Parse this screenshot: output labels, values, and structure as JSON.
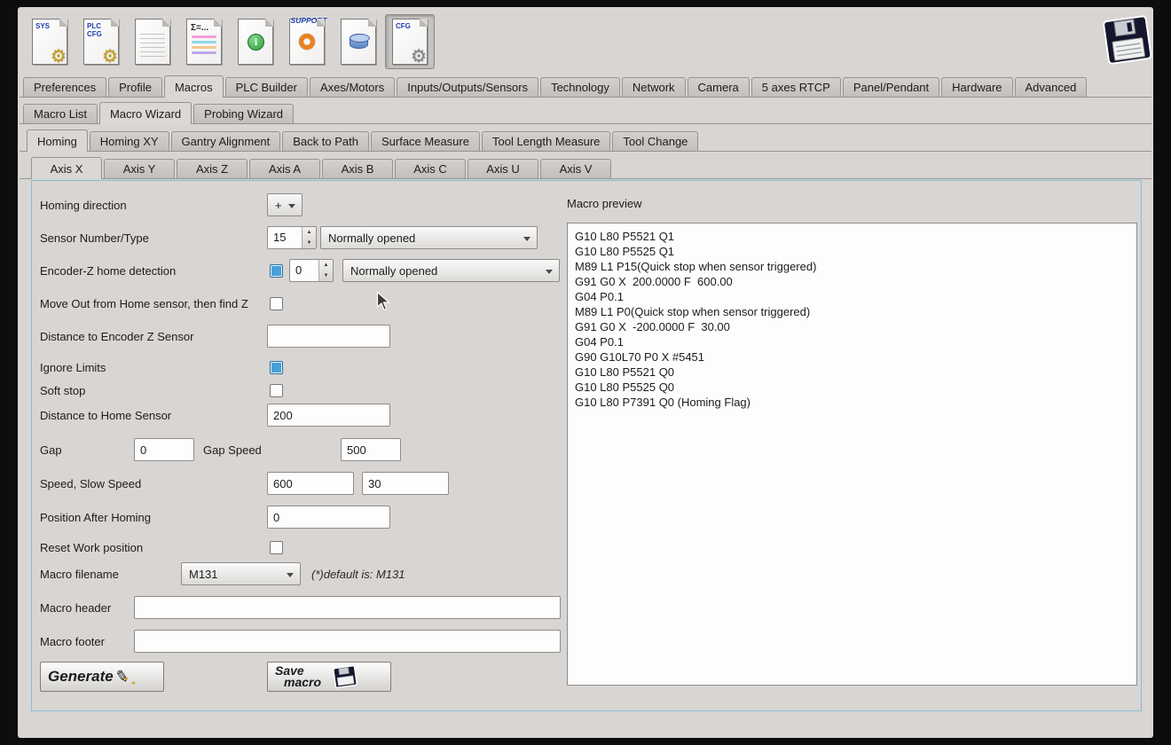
{
  "toolbar": {
    "icons": [
      {
        "name": "sys-config-icon",
        "label": "SYS"
      },
      {
        "name": "plc-cfg-icon",
        "label": "PLC\nCFG"
      },
      {
        "name": "document-icon",
        "label": ""
      },
      {
        "name": "macro-list-icon",
        "label": "Σ=..."
      },
      {
        "name": "info-icon",
        "label": "i"
      },
      {
        "name": "support-icon",
        "label": "SUPPORT"
      },
      {
        "name": "database-icon",
        "label": ""
      },
      {
        "name": "cfg-icon",
        "label": "CFG"
      }
    ]
  },
  "main_tabs": {
    "active": "Macros",
    "items": [
      "Preferences",
      "Profile",
      "Macros",
      "PLC Builder",
      "Axes/Motors",
      "Inputs/Outputs/Sensors",
      "Technology",
      "Network",
      "Camera",
      "5 axes RTCP",
      "Panel/Pendant",
      "Hardware",
      "Advanced"
    ]
  },
  "macro_tabs": {
    "active": "Macro Wizard",
    "items": [
      "Macro List",
      "Macro Wizard",
      "Probing Wizard"
    ]
  },
  "wizard_tabs": {
    "active": "Homing",
    "items": [
      "Homing",
      "Homing XY",
      "Gantry Alignment",
      "Back to Path",
      "Surface Measure",
      "Tool Length Measure",
      "Tool Change"
    ]
  },
  "axis_tabs": {
    "active": "Axis X",
    "items": [
      "Axis X",
      "Axis Y",
      "Axis Z",
      "Axis A",
      "Axis B",
      "Axis C",
      "Axis U",
      "Axis V"
    ]
  },
  "form": {
    "homing_direction": {
      "label": "Homing direction",
      "value": "+"
    },
    "sensor_number": {
      "label": "Sensor Number/Type",
      "value": "15",
      "type_value": "Normally opened"
    },
    "encoder_z": {
      "label": "Encoder-Z home detection",
      "checked": true,
      "value": "0",
      "type_value": "Normally opened"
    },
    "move_out": {
      "label": "Move Out from Home sensor, then find Z",
      "checked": false
    },
    "dist_encoder_z": {
      "label": "Distance to Encoder Z Sensor",
      "value": ""
    },
    "ignore_limits": {
      "label": "Ignore Limits",
      "checked": true
    },
    "soft_stop": {
      "label": "Soft stop",
      "checked": false
    },
    "dist_home": {
      "label": "Distance to Home Sensor",
      "value": "200"
    },
    "gap": {
      "label": "Gap",
      "value": "0",
      "speed_label": "Gap Speed",
      "speed_value": "500"
    },
    "speed": {
      "label": "Speed, Slow Speed",
      "value": "600",
      "slow_value": "30"
    },
    "position_after": {
      "label": "Position After Homing",
      "value": "0"
    },
    "reset_work": {
      "label": "Reset Work position",
      "checked": false
    },
    "macro_filename": {
      "label": "Macro filename",
      "value": "M131",
      "note": "(*)default is: M131"
    },
    "macro_header": {
      "label": "Macro header",
      "value": ""
    },
    "macro_footer": {
      "label": "Macro footer",
      "value": ""
    },
    "generate_button": "Generate",
    "save_button_line1": "Save",
    "save_button_line2": "macro"
  },
  "preview": {
    "label": "Macro preview",
    "lines": [
      "G10 L80 P5521 Q1",
      "G10 L80 P5525 Q1",
      "M89 L1 P15(Quick stop when sensor triggered)",
      "G91 G0 X  200.0000 F  600.00",
      "G04 P0.1",
      "M89 L1 P0(Quick stop when sensor triggered)",
      "G91 G0 X  -200.0000 F  30.00",
      "G04 P0.1",
      "G90 G10L70 P0 X #5451",
      "G10 L80 P5521 Q0",
      "G10 L80 P5525 Q0",
      "G10 L80 P7391 Q0 (Homing Flag)"
    ]
  }
}
